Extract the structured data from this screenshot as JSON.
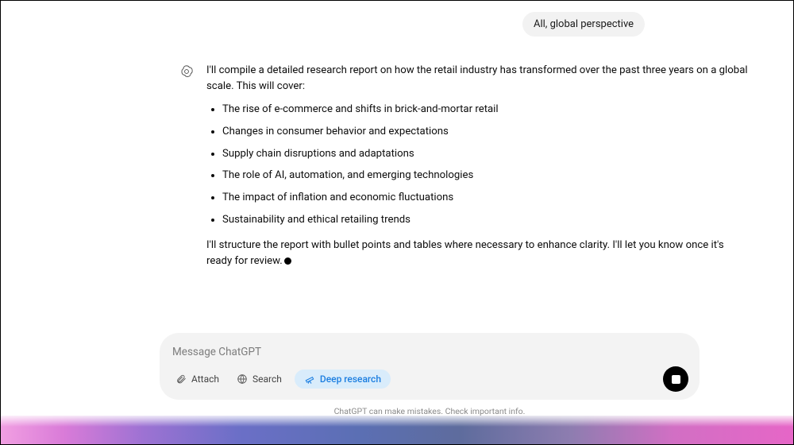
{
  "user_message": "All, global perspective",
  "assistant": {
    "intro": "I'll compile a detailed research report on how the retail industry has transformed over the past three years on a global scale. This will cover:",
    "bullets": [
      "The rise of e-commerce and shifts in brick-and-mortar retail",
      "Changes in consumer behavior and expectations",
      "Supply chain disruptions and adaptations",
      "The role of AI, automation, and emerging technologies",
      "The impact of inflation and economic fluctuations",
      "Sustainability and ethical retailing trends"
    ],
    "outro": "I'll structure the report with bullet points and tables where necessary to enhance clarity. I'll let you know once it's ready for review."
  },
  "composer": {
    "placeholder": "Message ChatGPT",
    "attach_label": "Attach",
    "search_label": "Search",
    "deep_label": "Deep research"
  },
  "footer": "ChatGPT can make mistakes. Check important info."
}
